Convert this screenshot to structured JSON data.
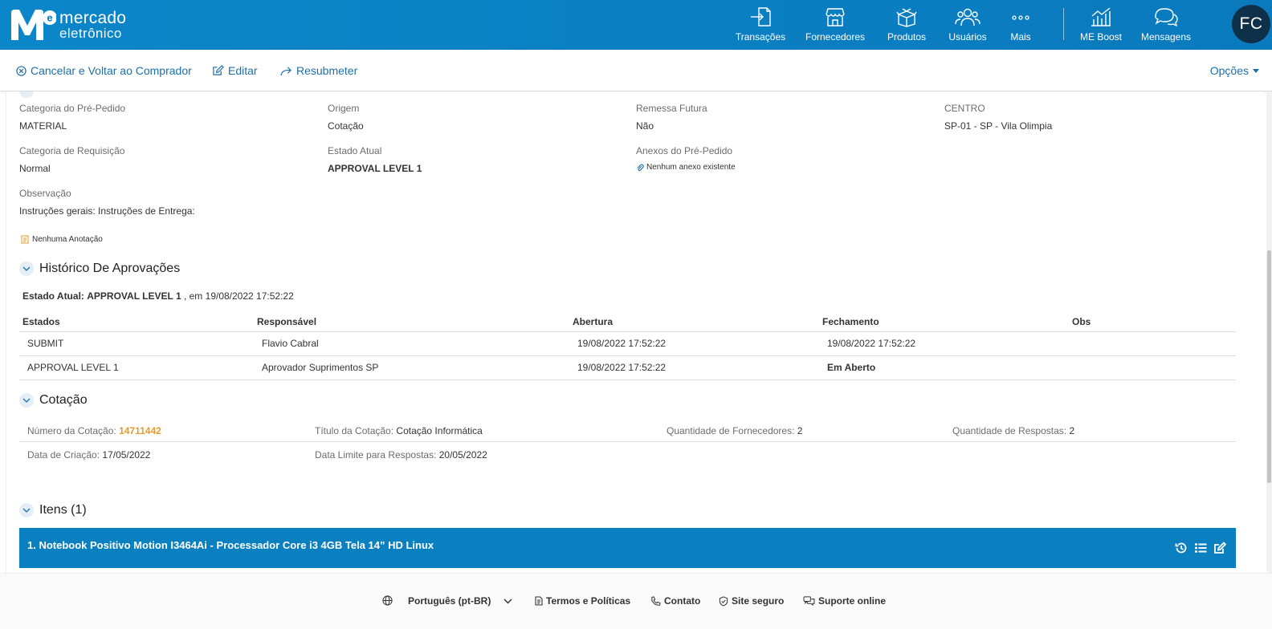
{
  "brand": {
    "line1": "mercado",
    "line2": "eletrônico",
    "mark_letter": "e"
  },
  "nav": {
    "items": [
      {
        "label": "Transações",
        "icon": "transactions-icon"
      },
      {
        "label": "Fornecedores",
        "icon": "suppliers-icon"
      },
      {
        "label": "Produtos",
        "icon": "products-icon"
      },
      {
        "label": "Usuários",
        "icon": "users-icon"
      },
      {
        "label": "Mais",
        "icon": "more-icon"
      },
      {
        "label": "ME Boost",
        "icon": "chart-icon"
      },
      {
        "label": "Mensagens",
        "icon": "messages-icon"
      }
    ],
    "avatar": "FC"
  },
  "actions": {
    "cancel": "Cancelar e Voltar ao Comprador",
    "edit": "Editar",
    "resubmit": "Resubmeter",
    "options": "Opções"
  },
  "details": {
    "categoria_pre_pedido": {
      "label": "Categoria do Pré-Pedido",
      "value": "MATERIAL"
    },
    "origem": {
      "label": "Origem",
      "value": "Cotação"
    },
    "remessa_futura": {
      "label": "Remessa Futura",
      "value": "Não"
    },
    "centro": {
      "label": "CENTRO",
      "value": "SP-01 - SP - Vila Olimpia"
    },
    "categoria_requisicao": {
      "label": "Categoria de Requisição",
      "value": "Normal"
    },
    "estado_atual": {
      "label": "Estado Atual",
      "value": "APPROVAL LEVEL 1"
    },
    "anexos": {
      "label": "Anexos do Pré-Pedido",
      "value": "Nenhum anexo existente"
    },
    "observacao": {
      "label": "Observação",
      "value": "Instruções gerais: Instruções de Entrega:"
    },
    "anotacao": "Nenhuma Anotação"
  },
  "historico": {
    "title": "Histórico De Aprovações",
    "estado_label": "Estado Atual:",
    "estado_value": "APPROVAL LEVEL 1",
    "estado_suffix": ", em 19/08/2022 17:52:22",
    "columns": [
      "Estados",
      "Responsável",
      "Abertura",
      "Fechamento",
      "Obs"
    ],
    "rows": [
      {
        "estado": "SUBMIT",
        "responsavel": "Flavio Cabral",
        "abertura": "19/08/2022 17:52:22",
        "fechamento": "19/08/2022 17:52:22",
        "obs": ""
      },
      {
        "estado": "APPROVAL LEVEL 1",
        "responsavel": "Aprovador Suprimentos SP",
        "abertura": "19/08/2022 17:52:22",
        "fechamento": "Em Aberto",
        "obs": ""
      }
    ]
  },
  "cotacao": {
    "title": "Cotação",
    "numero": {
      "label": "Número da Cotação:",
      "value": "14711442"
    },
    "titulo": {
      "label": "Título da Cotação:",
      "value": "Cotação Informática"
    },
    "qtd_fornecedores": {
      "label": "Quantidade de Fornecedores:",
      "value": "2"
    },
    "qtd_respostas": {
      "label": "Quantidade de Respostas:",
      "value": "2"
    },
    "data_criacao": {
      "label": "Data de Criação:",
      "value": "17/05/2022"
    },
    "data_limite": {
      "label": "Data Limite para Respostas:",
      "value": "20/05/2022"
    }
  },
  "itens": {
    "title": "Itens (1)",
    "first_item": "1. Notebook Positivo Motion I3464Ai - Processador Core i3 4GB Tela 14” HD Linux"
  },
  "footer": {
    "language": "Português (pt-BR)",
    "terms": "Termos e Políticas",
    "contact": "Contato",
    "secure": "Site seguro",
    "support": "Suporte online"
  },
  "colors": {
    "primary": "#0a7cc0",
    "link": "#1d6fa8",
    "accent": "#e69a2a",
    "avatar_bg": "#0f3049"
  }
}
